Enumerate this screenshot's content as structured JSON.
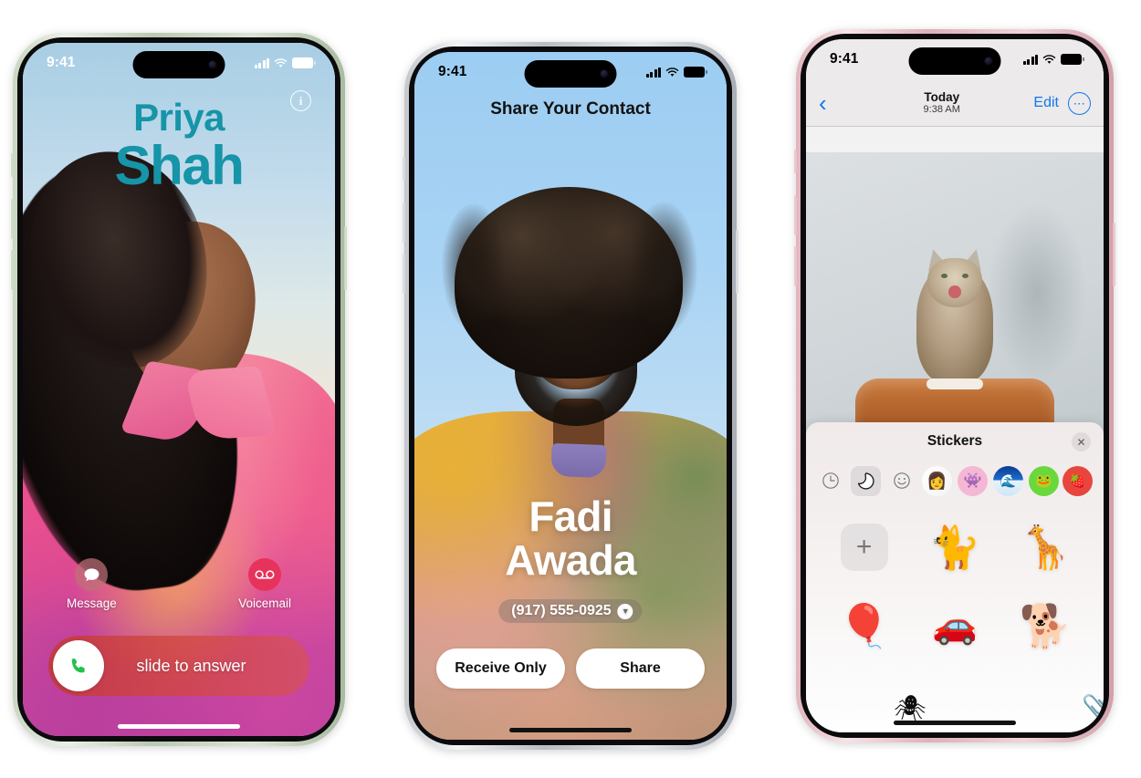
{
  "phones": [
    {
      "id": "incoming-call",
      "frame_color": "#c2d2ba",
      "status": {
        "time": "9:41",
        "signal_icon": "cellular-bars-icon",
        "wifi_icon": "wifi-icon",
        "battery_icon": "battery-icon"
      },
      "info_button": "i",
      "caller": {
        "first_name": "Priya",
        "last_name": "Shah",
        "name_color": "#1694a8"
      },
      "actions": [
        {
          "label": "Message",
          "icon": "message-bubble-icon"
        },
        {
          "label": "Voicemail",
          "icon": "voicemail-icon"
        }
      ],
      "slider": {
        "label": "slide to answer",
        "icon": "phone-handset-icon",
        "accent": "#c43a34"
      }
    },
    {
      "id": "share-contact",
      "frame_color": "#c8ccd2",
      "status": {
        "time": "9:41",
        "signal_icon": "cellular-bars-icon",
        "wifi_icon": "wifi-icon",
        "battery_icon": "battery-icon"
      },
      "title": "Share Your Contact",
      "contact": {
        "first_name": "Fadi",
        "last_name": "Awada",
        "phone": "(917) 555-0925",
        "chevron_icon": "chevron-down-icon"
      },
      "buttons": [
        {
          "label": "Receive Only"
        },
        {
          "label": "Share"
        }
      ]
    },
    {
      "id": "messages-stickers",
      "frame_color": "#e0b2bb",
      "status": {
        "time": "9:41",
        "signal_icon": "cellular-bars-icon",
        "wifi_icon": "wifi-icon",
        "battery_icon": "battery-icon"
      },
      "nav": {
        "back_icon": "chevron-left-icon",
        "day": "Today",
        "time": "9:38 AM",
        "edit_label": "Edit",
        "more_icon": "ellipsis-icon",
        "accent": "#1177ef"
      },
      "photo": {
        "alt": "cat-photo"
      },
      "stickers_panel": {
        "title": "Stickers",
        "close_icon": "close-icon",
        "tabs": [
          {
            "name": "recents-tab",
            "icon": "clock-icon",
            "glyph": "◴",
            "selected": false
          },
          {
            "name": "my-stickers-tab",
            "icon": "sticker-peel-icon",
            "glyph": "◗",
            "selected": true
          },
          {
            "name": "emoji-tab",
            "icon": "smiley-icon",
            "glyph": "☺",
            "selected": false
          },
          {
            "name": "pack-tab-1",
            "icon": "sticker-pack-icon",
            "glyph": "👩",
            "selected": false
          },
          {
            "name": "pack-tab-2",
            "icon": "sticker-pack-icon",
            "glyph": "👾",
            "selected": false
          },
          {
            "name": "pack-tab-3",
            "icon": "sticker-pack-icon",
            "glyph": "🌊",
            "selected": false
          },
          {
            "name": "pack-tab-4",
            "icon": "sticker-pack-icon",
            "glyph": "🐸",
            "selected": false
          },
          {
            "name": "pack-tab-5",
            "icon": "sticker-pack-icon",
            "glyph": "🍓",
            "selected": false
          }
        ],
        "add_button": "+",
        "stickers": [
          {
            "name": "sticker-cat",
            "glyph": "🐈"
          },
          {
            "name": "sticker-giraffe",
            "glyph": "🦒"
          },
          {
            "name": "sticker-hot-air-balloon",
            "glyph": "🎈"
          },
          {
            "name": "sticker-red-car",
            "glyph": "🚗"
          },
          {
            "name": "sticker-dog-sunglasses",
            "glyph": "🐕"
          },
          {
            "name": "sticker-partial-spider",
            "glyph": "🕷"
          },
          {
            "name": "sticker-partial-paperclip",
            "glyph": "📎"
          }
        ]
      }
    }
  ]
}
